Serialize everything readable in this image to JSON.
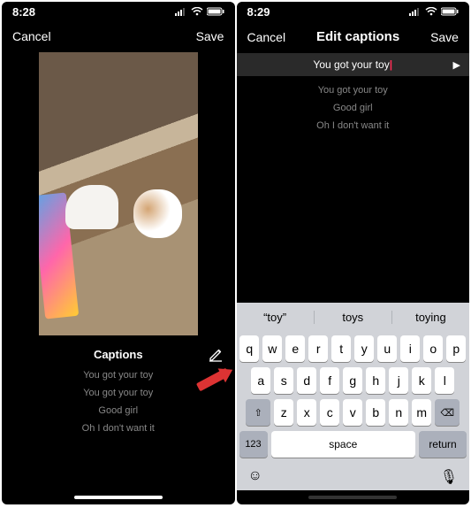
{
  "left": {
    "time": "8:28",
    "cancel": "Cancel",
    "save": "Save",
    "captions_label": "Captions",
    "captions": [
      "You got your toy",
      "You got your toy",
      "Good girl",
      "Oh I don't want it"
    ]
  },
  "right": {
    "time": "8:29",
    "cancel": "Cancel",
    "title": "Edit captions",
    "save": "Save",
    "active_caption": "You got your toy",
    "captions": [
      "You got your toy",
      "Good girl",
      "Oh I don't want it"
    ],
    "suggestions": [
      "“toy”",
      "toys",
      "toying"
    ],
    "keyboard_rows": [
      [
        "q",
        "w",
        "e",
        "r",
        "t",
        "y",
        "u",
        "i",
        "o",
        "p"
      ],
      [
        "a",
        "s",
        "d",
        "f",
        "g",
        "h",
        "j",
        "k",
        "l"
      ],
      [
        "z",
        "x",
        "c",
        "v",
        "b",
        "n",
        "m"
      ]
    ],
    "shift": "⇧",
    "backspace": "⌫",
    "num_key": "123",
    "space": "space",
    "return": "return",
    "emoji": "☺",
    "mic": "🎙"
  }
}
